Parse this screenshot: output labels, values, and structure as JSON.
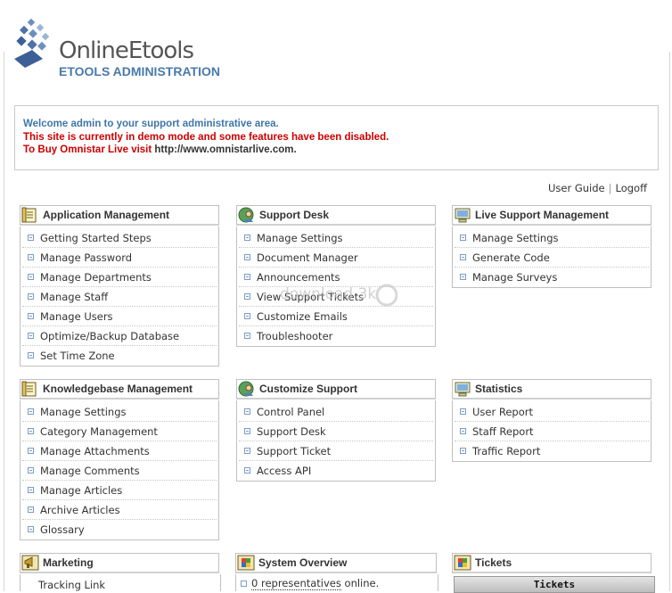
{
  "brand": {
    "name": "OnlineEtools",
    "subtitle": "ETOOLS ADMINISTRATION"
  },
  "welcome": {
    "line1": "Welcome admin to your support administrative area.",
    "line2": "This site is currently in demo mode and some features have been disabled.",
    "line3_prefix": "To Buy Omnistar Live visit ",
    "line3_url": "http://www.omnistarlive.com",
    "line3_suffix": "."
  },
  "top_links": {
    "user_guide": "User Guide",
    "separator": "|",
    "logoff": "Logoff"
  },
  "watermark": "download 3k",
  "panels": {
    "app": {
      "title": "Application Management",
      "icon": "notepad-icon",
      "items": [
        "Getting Started Steps",
        "Manage Password",
        "Manage Departments",
        "Manage Staff",
        "Manage Users",
        "Optimize/Backup Database",
        "Set Time Zone"
      ]
    },
    "support": {
      "title": "Support Desk",
      "icon": "support-user-icon",
      "items": [
        "Manage Settings",
        "Document Manager",
        "Announcements",
        "View Support Tickets",
        "Customize Emails",
        "Troubleshooter"
      ]
    },
    "live": {
      "title": "Live Support Management",
      "icon": "monitor-icon",
      "items": [
        "Manage Settings",
        "Generate Code",
        "Manage Surveys"
      ]
    },
    "kb": {
      "title": "Knowledgebase Management",
      "icon": "notepad-icon",
      "items": [
        "Manage Settings",
        "Category Management",
        "Manage Attachments",
        "Manage Comments",
        "Manage Articles",
        "Archive Articles",
        "Glossary"
      ]
    },
    "customize": {
      "title": "Customize Support",
      "icon": "support-user-icon",
      "items": [
        "Control Panel",
        "Support Desk",
        "Support Ticket",
        "Access API"
      ]
    },
    "stats": {
      "title": "Statistics",
      "icon": "monitor-icon",
      "items": [
        "User Report",
        "Staff Report",
        "Traffic Report"
      ]
    },
    "marketing": {
      "title": "Marketing",
      "icon": "megaphone-icon",
      "items": [
        "Tracking Link"
      ]
    },
    "system": {
      "title": "System Overview",
      "icon": "windows-icon",
      "line_link": "0 representatives",
      "line_rest": " online."
    },
    "tickets": {
      "title": "Tickets",
      "icon": "windows-icon",
      "bar_label": "Tickets"
    }
  }
}
